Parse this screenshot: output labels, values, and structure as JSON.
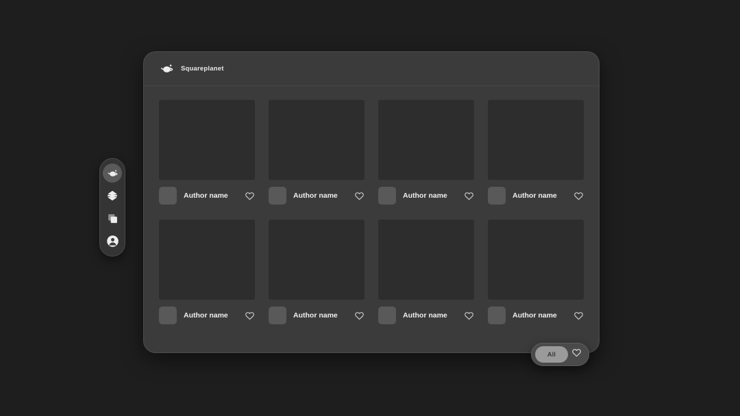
{
  "app": {
    "background_color": "#1e1e1e",
    "panel_color": "#3b3b3b",
    "accent_color": "#9a9a9a"
  },
  "sidebar": {
    "items": [
      {
        "icon": "planet-icon",
        "label": "Squareplanet",
        "active": true
      },
      {
        "icon": "layers-icon",
        "label": "Layers",
        "active": false
      },
      {
        "icon": "copy-icon",
        "label": "Copy",
        "active": false
      },
      {
        "icon": "profile-icon",
        "label": "Profile",
        "active": false
      }
    ]
  },
  "header": {
    "logo_icon": "planet-icon",
    "title": "Squareplanet"
  },
  "grid": {
    "cards": [
      {
        "author": "Author name",
        "like_icon": "heart-outline-icon"
      },
      {
        "author": "Author name",
        "like_icon": "heart-outline-icon"
      },
      {
        "author": "Author name",
        "like_icon": "heart-outline-icon"
      },
      {
        "author": "Author name",
        "like_icon": "heart-outline-icon"
      },
      {
        "author": "Author name",
        "like_icon": "heart-outline-icon"
      },
      {
        "author": "Author name",
        "like_icon": "heart-outline-icon"
      },
      {
        "author": "Author name",
        "like_icon": "heart-outline-icon"
      },
      {
        "author": "Author name",
        "like_icon": "heart-outline-icon"
      }
    ]
  },
  "filter_bar": {
    "all_label": "All",
    "like_icon": "heart-outline-icon"
  }
}
